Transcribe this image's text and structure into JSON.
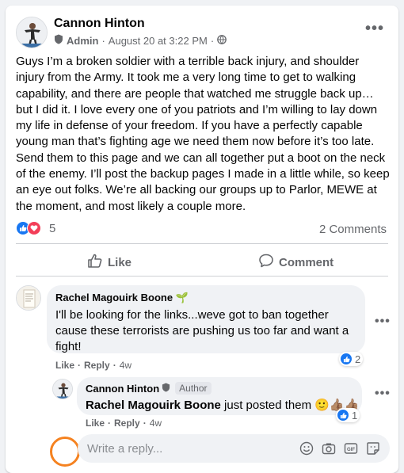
{
  "post": {
    "author": "Cannon Hinton",
    "role": "Admin",
    "separator": "·",
    "date": "August 20 at 3:22 PM",
    "separator2": "·",
    "text": "Guys I’m a broken soldier with a terrible back injury, and shoulder injury from the Army. It took me a very long time to get to walking capability, and there are people that watched me struggle back up… but I did it. I love every one of you patriots and I’m willing to lay down my life in defense of your freedom. If you have a perfectly capable young man that’s fighting age we need them now before it’s too late. Send them to this page and we can all together put a boot on the neck of the enemy. I’ll post the backup pages I made in a little while, so keep an eye out folks. We’re all backing our groups up to Parlor, MEWE at the moment, and most likely a couple more.",
    "reaction_count": "5",
    "comments_count": "2 Comments",
    "like_label": "Like",
    "comment_label": "Comment"
  },
  "comments": [
    {
      "author": "Rachel Magouirk Boone",
      "author_suffix": "🌱",
      "text": "I'll be looking for the links...weve got to ban together cause these terrorists are pushing us too far and want a fight!",
      "like_label": "Like",
      "dot": "·",
      "reply_label": "Reply",
      "dot2": "·",
      "time": "4w",
      "reaction_count": "2"
    },
    {
      "author": "Cannon Hinton",
      "badge": "Author",
      "mention": "Rachel Magouirk Boone",
      "text": " just posted them 🙂👍🏽👍🏽",
      "like_label": "Like",
      "dot": "·",
      "reply_label": "Reply",
      "dot2": "·",
      "time": "4w",
      "reaction_count": "1"
    }
  ],
  "reply": {
    "placeholder": "Write a reply..."
  },
  "icons": {
    "privacy": "globe-icon",
    "role": "shield-icon",
    "reply_tools": [
      "emoji-icon",
      "camera-icon",
      "gif-icon",
      "sticker-icon"
    ]
  },
  "colors": {
    "like_blue": "#1877f2",
    "love_red": "#f33e58",
    "highlight_orange": "#f58220"
  }
}
